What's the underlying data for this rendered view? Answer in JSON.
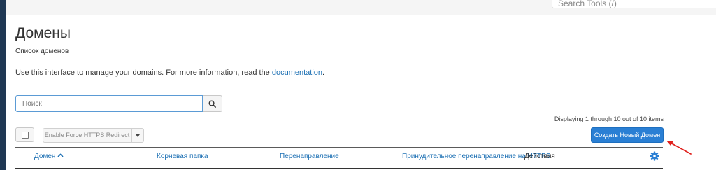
{
  "header": {
    "search_placeholder": "Search Tools (/)"
  },
  "page": {
    "title": "Домены",
    "subtitle": "Список доменов",
    "intro_text": "Use this interface to manage your domains. For more information, read the ",
    "intro_link": "documentation",
    "intro_end": "."
  },
  "search": {
    "placeholder": "Поиск"
  },
  "pagination": {
    "displaying": "Displaying 1 through 10 out of 10 items"
  },
  "toolbar": {
    "force_https_label": "Enable Force HTTPS Redirect",
    "create_domain_label": "Создать Новый Домен"
  },
  "table": {
    "columns": [
      {
        "label": "Домен",
        "sorted": "asc"
      },
      {
        "label": "Корневая папка"
      },
      {
        "label": "Перенаправление"
      },
      {
        "label": "Принудительное перенаправление на HTTPS"
      },
      {
        "label": "Действия"
      }
    ]
  },
  "icons": {
    "search": "search-icon",
    "settings": "gear-icon",
    "caret": "caret-down-icon",
    "sort": "sort-asc-icon",
    "annotation": "red-arrow-icon"
  },
  "colors": {
    "primary": "#2a7fd4",
    "link": "#1b6fb3",
    "annotation": "#e0211d",
    "sidebar": "#1f3854"
  }
}
